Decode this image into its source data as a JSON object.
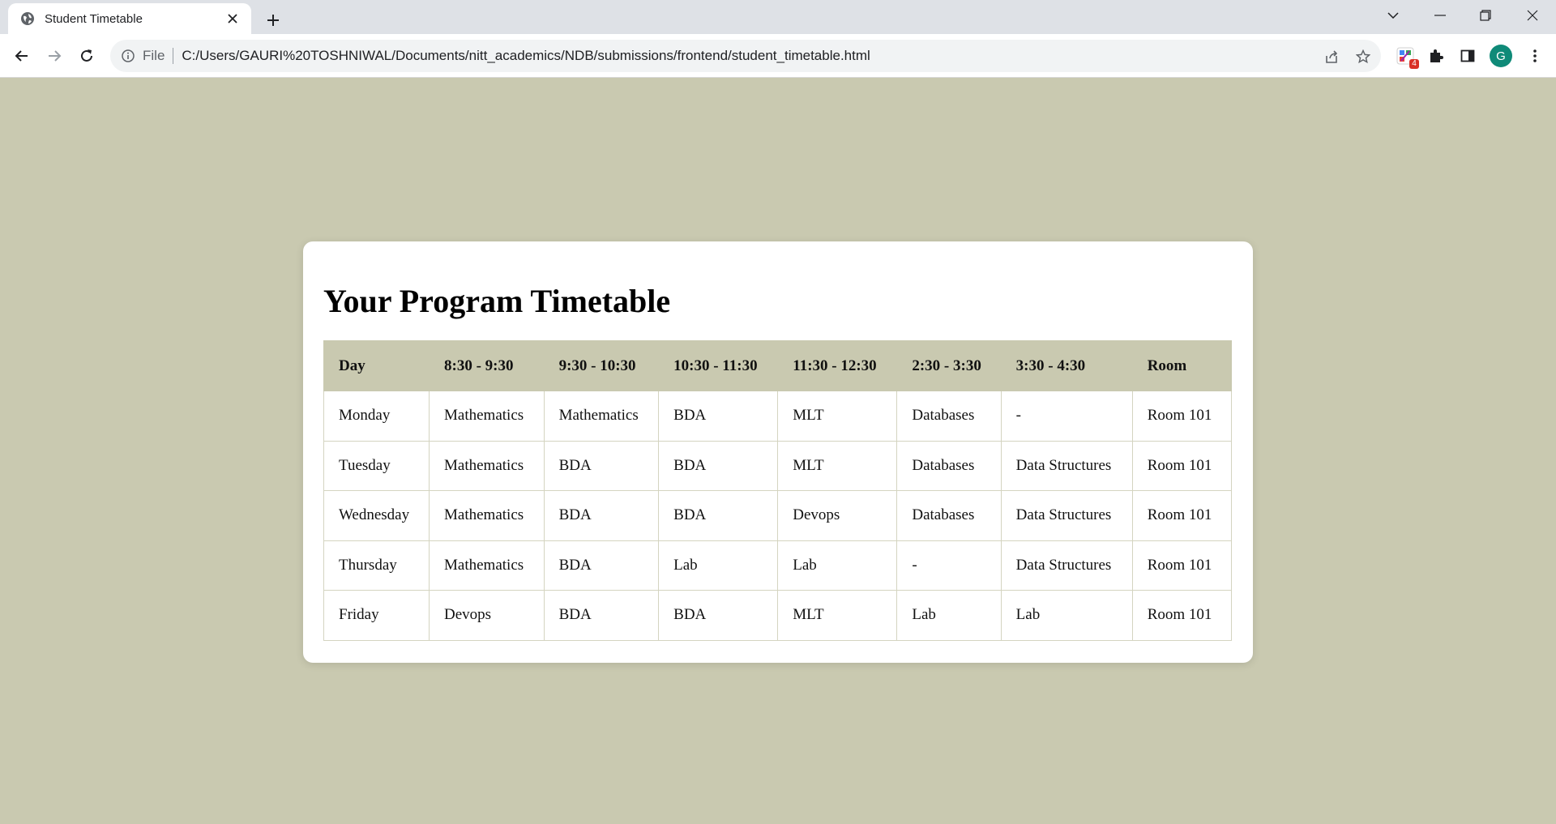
{
  "browser": {
    "tab_title": "Student Timetable",
    "file_label": "File",
    "url": "C:/Users/GAURI%20TOSHNIWAL/Documents/nitt_academics/NDB/submissions/frontend/student_timetable.html",
    "extension_badge": "4",
    "avatar_initial": "G"
  },
  "page": {
    "title": "Your Program Timetable"
  },
  "timetable": {
    "headers": [
      "Day",
      "8:30 - 9:30",
      "9:30 - 10:30",
      "10:30 - 11:30",
      "11:30 - 12:30",
      "2:30 - 3:30",
      "3:30 - 4:30",
      "Room"
    ],
    "rows": [
      [
        "Monday",
        "Mathematics",
        "Mathematics",
        "BDA",
        "MLT",
        "Databases",
        "-",
        "Room 101"
      ],
      [
        "Tuesday",
        "Mathematics",
        "BDA",
        "BDA",
        "MLT",
        "Databases",
        "Data Structures",
        "Room 101"
      ],
      [
        "Wednesday",
        "Mathematics",
        "BDA",
        "BDA",
        "Devops",
        "Databases",
        "Data Structures",
        "Room 101"
      ],
      [
        "Thursday",
        "Mathematics",
        "BDA",
        "Lab",
        "Lab",
        "-",
        "Data Structures",
        "Room 101"
      ],
      [
        "Friday",
        "Devops",
        "BDA",
        "BDA",
        "MLT",
        "Lab",
        "Lab",
        "Room 101"
      ]
    ]
  },
  "colors": {
    "page_background": "#c9c9b0",
    "header_background": "#c9c9b0",
    "card_background": "#ffffff"
  },
  "icons": {
    "tab_favicon": "globe-icon",
    "tab_close": "close-icon",
    "new_tab": "plus-icon",
    "back": "arrow-left-icon",
    "forward": "arrow-right-icon",
    "reload": "reload-icon",
    "site_info": "info-icon",
    "share": "share-icon",
    "bookmark": "star-icon",
    "extensions": "puzzle-icon",
    "side_panel": "side-panel-icon",
    "menu": "kebab-menu-icon"
  }
}
